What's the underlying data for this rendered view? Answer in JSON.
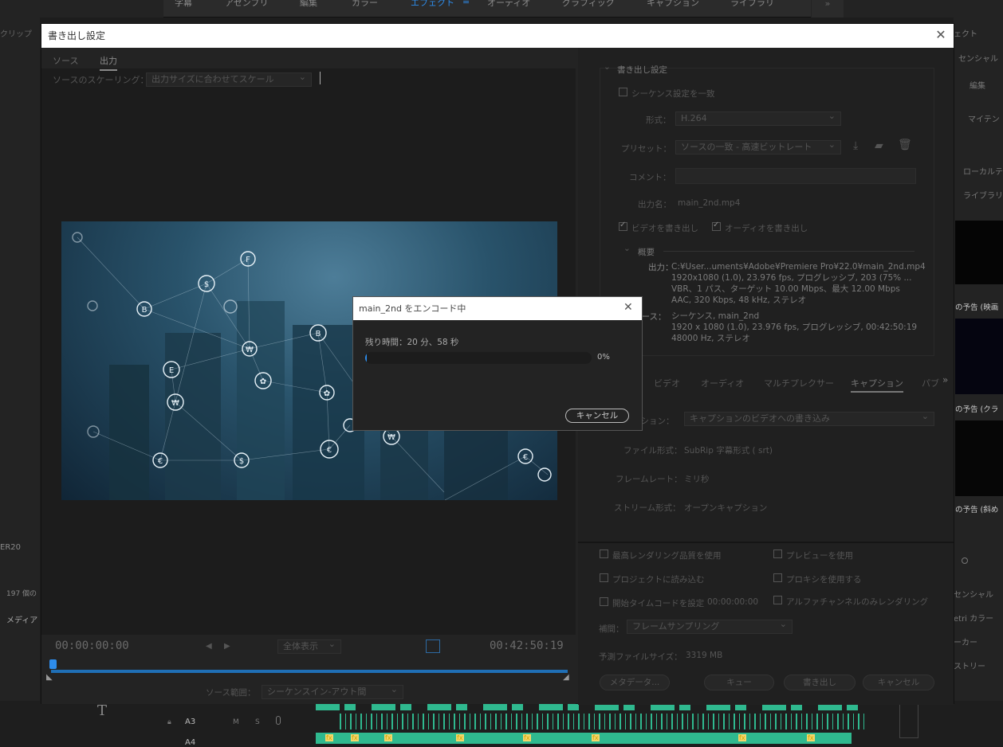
{
  "app": {
    "workspaces": [
      "字幕",
      "アセンブリ",
      "編集",
      "カラー",
      "エフェクト",
      "オーディオ",
      "グラフィック",
      "キャプション",
      "ライブラリ"
    ],
    "active_workspace": "エフェクト",
    "overflow": "»"
  },
  "background": {
    "left_panel": [
      "クリップ",
      "ER20",
      "197 個の",
      "メディア"
    ],
    "right_panel": [
      "ェクト",
      "センシャル",
      "編集",
      "マイテン",
      "ローカルテ",
      "ライブラリ",
      "の予告 (映画",
      "の予告 (クラ",
      "の予告 (斜め",
      "センシャル",
      "etri カラー",
      "ーカー",
      "ストリー"
    ],
    "timeline": {
      "track_a3": "A3",
      "track_a4": "A4",
      "mute": "M",
      "solo": "S",
      "fx": "fx"
    }
  },
  "export_dialog": {
    "title": "書き出し設定",
    "close": "✕",
    "tabs": [
      "ソース",
      "出力"
    ],
    "active_tab": "出力",
    "scaling_label": "ソースのスケーリング：",
    "scaling_value": "出力サイズに合わせてスケール",
    "timecode_start": "00:00:00:00",
    "timecode_end": "00:42:50:19",
    "zoom_value": "全体表示",
    "source_range_label": "ソース範囲：",
    "source_range_value": "シーケンスイン-アウト間",
    "export_settings": {
      "header": "書き出し設定",
      "match_sequence": "シーケンス設定を一致",
      "format_label": "形式：",
      "format_value": "H.264",
      "preset_label": "プリセット：",
      "preset_value": "ソースの一致 - 高速ビットレート",
      "comment_label": "コメント：",
      "output_name_label": "出力名：",
      "output_name_value": "main_2nd.mp4",
      "export_video": "ビデオを書き出し",
      "export_audio": "オーディオを書き出し",
      "summary_header": "概要",
      "output_label": "出力：",
      "output_lines": [
        "C:¥User...uments¥Adobe¥Premiere Pro¥22.0¥main_2nd.mp4",
        "1920x1080 (1.0), 23.976 fps, プログレッシブ, 203 (75% ...",
        "VBR、1 パス、ターゲット 10.00 Mbps、最大 12.00 Mbps",
        "AAC, 320 Kbps, 48 kHz, ステレオ"
      ],
      "source_label": "ソース：",
      "source_lines": [
        "シーケンス, main_2nd",
        "1920 x 1080 (1.0), 23.976 fps, プログレッシブ, 00:42:50:19",
        "48000 Hz, ステレオ"
      ]
    },
    "subtabs": [
      "ビデオ",
      "オーディオ",
      "マルチプレクサー",
      "キャプション",
      "パブ"
    ],
    "active_subtab": "キャプション",
    "caption": {
      "option_label": "プション：",
      "option_value": "キャプションのビデオへの書き込み",
      "file_format_label": "ファイル形式：",
      "file_format_value": "SubRip 字幕形式 ( srt)",
      "frame_rate_label": "フレームレート：",
      "frame_rate_value": "ミリ秒",
      "stream_format_label": "ストリーム形式：",
      "stream_format_value": "オープンキャプション"
    },
    "options": {
      "max_render_quality": "最高レンダリング品質を使用",
      "use_preview": "プレビューを使用",
      "import_project": "プロジェクトに読み込む",
      "use_proxy": "プロキシを使用する",
      "set_start_timecode": "開始タイムコードを設定",
      "start_timecode_value": "00:00:00:00",
      "alpha_only": "アルファチャンネルのみレンダリング",
      "interpolation_label": "補間：",
      "interpolation_value": "フレームサンプリング",
      "file_size_label": "予測ファイルサイズ：",
      "file_size_value": "3319 MB"
    },
    "buttons": {
      "metadata": "メタデータ...",
      "queue": "キュー",
      "export": "書き出し",
      "cancel": "キャンセル"
    }
  },
  "encode_modal": {
    "title": "main_2nd をエンコード中",
    "remaining": "残り時間：20 分、58 秒",
    "progress_percent": "0%",
    "progress_value": 0.004,
    "cancel": "キャンセル",
    "close": "✕"
  },
  "colors": {
    "accent": "#2d8ceb",
    "dialog_bg": "#232323",
    "title_bar": "#ffffff",
    "timeline_clip": "#2fb98f"
  }
}
